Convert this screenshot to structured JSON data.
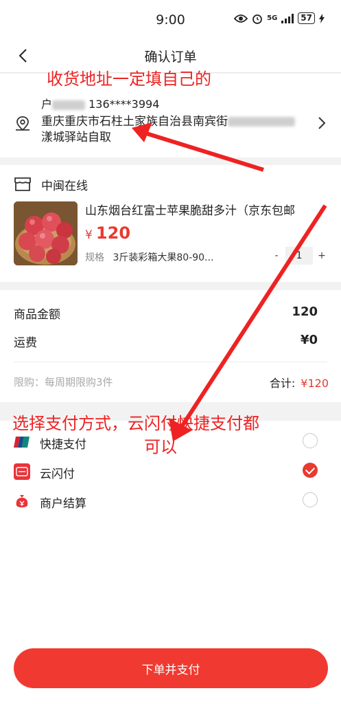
{
  "status_bar": {
    "time": "9:00",
    "network": "5G",
    "battery": "57"
  },
  "navbar": {
    "title": "确认订单"
  },
  "address": {
    "recipient_prefix": "户",
    "phone": "136****3994",
    "line1_visible": "重庆重庆市石柱土家族自治县南宾街",
    "line2": "漾城驿站自取"
  },
  "shop": {
    "name": "中闽在线"
  },
  "product": {
    "title": "山东烟台红富士苹果脆甜多汁（京东包邮",
    "price_symbol": "¥",
    "price": "120",
    "spec_label": "规格",
    "spec_value": "3斤装彩箱大果80-90...",
    "quantity": "1",
    "minus": "-",
    "plus": "+"
  },
  "summary": {
    "goods_amount_label": "商品金额",
    "goods_amount": "120",
    "shipping_label": "运费",
    "shipping": "¥0",
    "limit_text": "限购：每周期限购3件",
    "total_label": "合计:",
    "total": "¥120"
  },
  "payment": {
    "options": [
      {
        "label": "快捷支付",
        "icon": "unionpay-icon",
        "selected": false
      },
      {
        "label": "云闪付",
        "icon": "cloud-quickpass-icon",
        "selected": true
      },
      {
        "label": "商户结算",
        "icon": "merchant-bag-icon",
        "selected": false
      }
    ]
  },
  "submit": {
    "label": "下单并支付"
  },
  "annotations": {
    "address_note": "收货地址一定填自己的",
    "payment_note_line1": "选择支付方式，云闪付快捷支付都",
    "payment_note_line2": "可以",
    "color": "#ee2222"
  },
  "colors": {
    "accent": "#f03a31",
    "price": "#e83a30"
  }
}
